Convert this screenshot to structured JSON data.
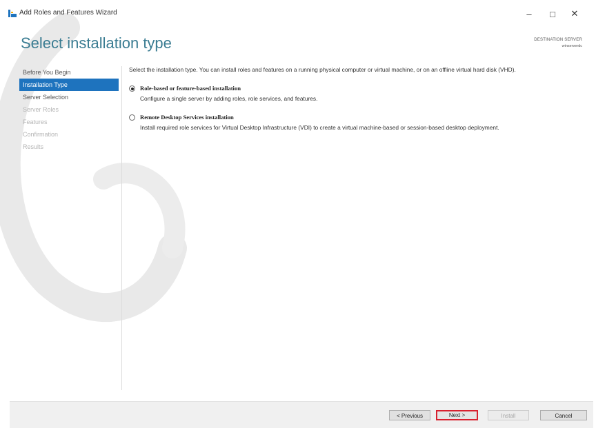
{
  "window": {
    "title": "Add Roles and Features Wizard",
    "controls": {
      "minimize": "–",
      "maximize": "□",
      "close": "✕"
    }
  },
  "header": {
    "page_title": "Select installation type",
    "destination_label": "DESTINATION SERVER",
    "destination_value": "winserverdc"
  },
  "nav": {
    "items": [
      {
        "label": "Before You Begin",
        "state": "enabled"
      },
      {
        "label": "Installation Type",
        "state": "active"
      },
      {
        "label": "Server Selection",
        "state": "enabled"
      },
      {
        "label": "Server Roles",
        "state": "disabled"
      },
      {
        "label": "Features",
        "state": "disabled"
      },
      {
        "label": "Confirmation",
        "state": "disabled"
      },
      {
        "label": "Results",
        "state": "disabled"
      }
    ]
  },
  "content": {
    "intro": "Select the installation type. You can install roles and features on a running physical computer or virtual machine, or on an offline virtual hard disk (VHD).",
    "options": [
      {
        "title": "Role-based or feature-based installation",
        "description": "Configure a single server by adding roles, role services, and features.",
        "selected": true
      },
      {
        "title": "Remote Desktop Services installation",
        "description": "Install required role services for Virtual Desktop Infrastructure (VDI) to create a virtual machine-based or session-based desktop deployment.",
        "selected": false
      }
    ]
  },
  "footer": {
    "previous": "< Previous",
    "next": "Next >",
    "install": "Install",
    "cancel": "Cancel"
  },
  "colors": {
    "accent": "#1e73be",
    "title": "#3a7c92",
    "highlight_border": "#d8212f"
  }
}
